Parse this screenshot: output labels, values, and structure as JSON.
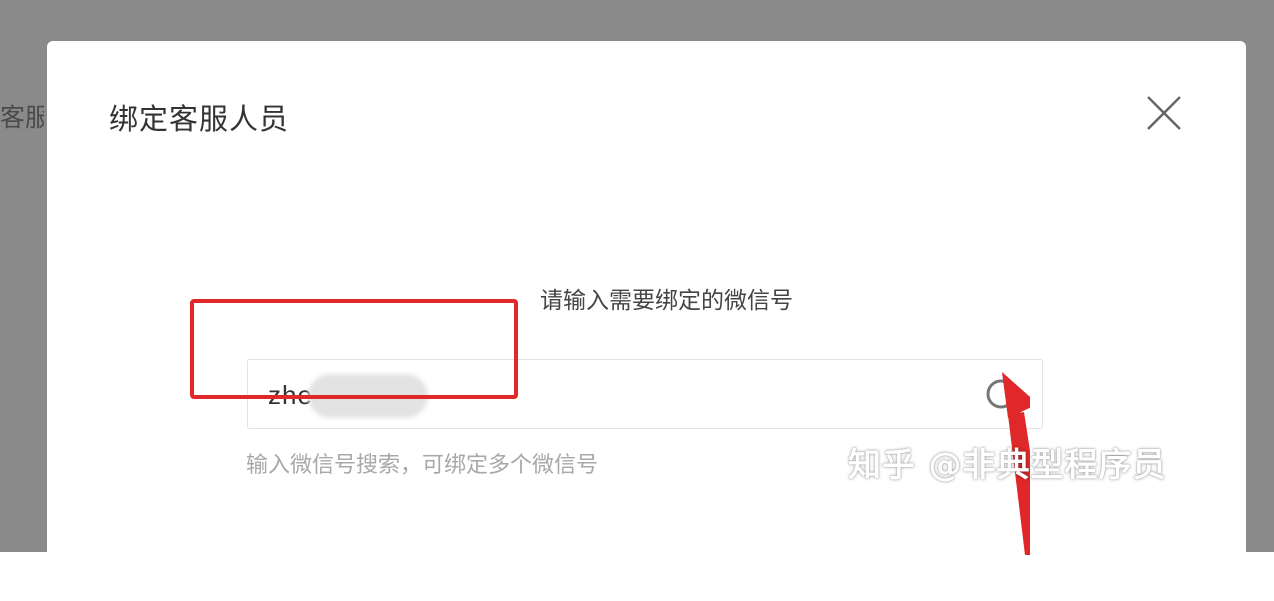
{
  "background": {
    "partial_label": "客服"
  },
  "modal": {
    "title": "绑定客服人员",
    "prompt": "请输入需要绑定的微信号",
    "search": {
      "value": "zhe          8",
      "hint": "输入微信号搜索，可绑定多个微信号"
    }
  },
  "watermark": {
    "text": "知乎 @非典型程序员"
  },
  "colors": {
    "highlight": "#e0282a",
    "overlay": "#8a8a8a"
  },
  "icons": {
    "close": "close-icon",
    "search": "search-icon",
    "annotation": "red-arrow-icon"
  }
}
